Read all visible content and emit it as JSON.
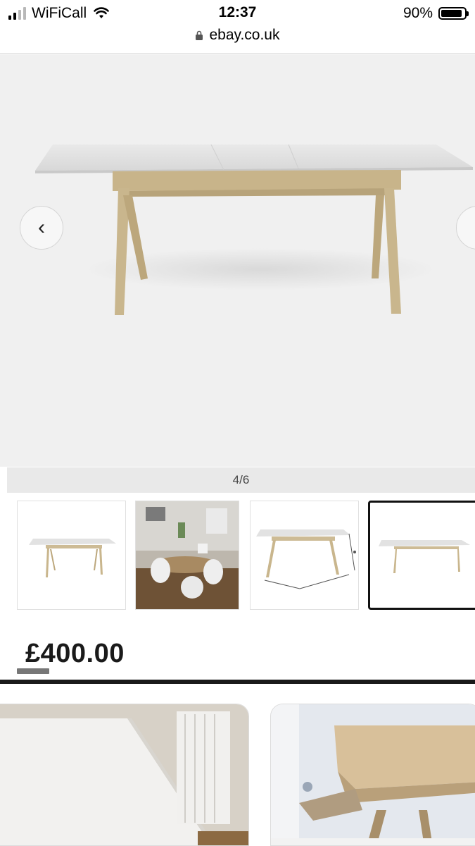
{
  "status_bar": {
    "carrier": "WiFiCall",
    "time": "12:37",
    "url": "ebay.co.uk",
    "battery": "90%",
    "battery_level": 0.9
  },
  "gallery": {
    "counter": "4/6",
    "prev_icon": "chevron-left-icon",
    "next_icon": "chevron-right-icon",
    "thumbnails": [
      "table-white-background",
      "dining-room-photo",
      "table-dimensions",
      "table-extended"
    ],
    "selected_thumbnail": 4
  },
  "listing": {
    "price": "£400.00"
  },
  "related": {
    "cards": [
      "white-tabletop-photo",
      "table-leg-closeup-photo"
    ]
  },
  "colors": {
    "gallery_bg": "#f0f0f0",
    "table_top": "#e0e0e0",
    "wood": "#c8b48a"
  }
}
